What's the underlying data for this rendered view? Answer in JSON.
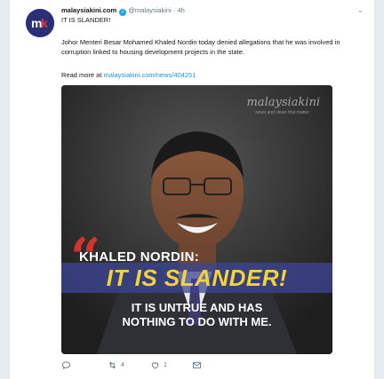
{
  "tweet": {
    "author": "malaysiakini.com",
    "handle": "@malaysiakini",
    "dot": "·",
    "time": "4h",
    "headline": "IT IS SLANDER!",
    "body": "Johor Menteri Besar Mohamed Khaled Nordin today denied allegations that he was involved in corruption linked to housing development projects in the state.",
    "read_more_label": "Read more at",
    "read_more_link": "malaysiakini.com/news/404251"
  },
  "media": {
    "watermark": "malaysiakini",
    "watermark_sub": "news and views that matter",
    "speaker": "KHALED NORDIN:",
    "quote_main": "IT IS SLANDER!",
    "quote_line1": "IT IS UNTRUE AND HAS",
    "quote_line2": "NOTHING TO DO WITH ME."
  },
  "actions": {
    "reply_count": "",
    "retweet_count": "4",
    "like_count": "1"
  },
  "colors": {
    "link": "#1b95e0",
    "verified": "#1da1f2",
    "band": "#3c4696",
    "quote_yellow": "#f3d33a",
    "quote_mark_red": "#d0342c"
  }
}
